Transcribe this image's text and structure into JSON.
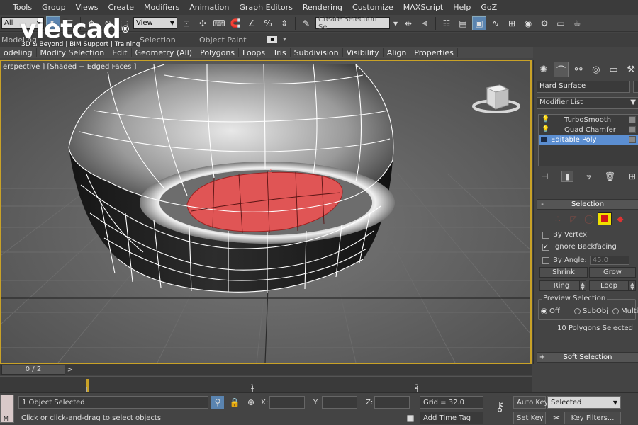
{
  "menu": [
    "Tools",
    "Group",
    "Views",
    "Create",
    "Modifiers",
    "Animation",
    "Graph Editors",
    "Rendering",
    "Customize",
    "MAXScript",
    "Help",
    "GoZ"
  ],
  "toolbar": {
    "filter_value": "All",
    "refcoord_value": "View",
    "named_selection_placeholder": "Create Selection Se"
  },
  "logo": {
    "brand": "vietcad",
    "registered": "®",
    "tagline": "3D & Beyond | BIM Support | Training"
  },
  "ribbon": {
    "row1": [
      "Modeling",
      "Selection",
      "Object Paint"
    ],
    "row2": [
      "odeling",
      "Modify Selection",
      "Edit",
      "Geometry (All)",
      "Polygons",
      "Loops",
      "Tris",
      "Subdivision",
      "Visibility",
      "Align",
      "Properties"
    ]
  },
  "viewport": {
    "label": "erspective ] [Shaded + Edged Faces ]"
  },
  "command_panel": {
    "object_name": "Hard Surface",
    "modifier_list": "Modifier List",
    "stack": [
      {
        "name": "TurboSmooth",
        "selected": false
      },
      {
        "name": "Quad Chamfer",
        "selected": false
      },
      {
        "name": "Editable Poly",
        "selected": true
      }
    ],
    "selection_rollout": {
      "title": "Selection",
      "by_vertex": "By Vertex",
      "ignore_backfacing": "Ignore Backfacing",
      "ignore_backfacing_checked": true,
      "by_angle": "By Angle:",
      "angle_value": "45.0",
      "shrink": "Shrink",
      "grow": "Grow",
      "ring": "Ring",
      "loop": "Loop",
      "preview_selection": "Preview Selection",
      "preview_options": [
        "Off",
        "SubObj",
        "Multi"
      ],
      "preview_selected": "Off",
      "status": "10 Polygons Selected"
    },
    "soft_selection_title": "Soft Selection",
    "minus": "-",
    "plus": "+"
  },
  "timeline": {
    "frame_counter": "0 / 2",
    "next_label": ">",
    "tick_labels": [
      "1",
      "2"
    ]
  },
  "statusbar": {
    "selected_text": "1 Object Selected",
    "prompt": "Click or click-and-drag to select objects",
    "x_label": "X:",
    "y_label": "Y:",
    "z_label": "Z:",
    "grid": "Grid = 32.0",
    "add_time_tag": "Add Time Tag",
    "auto_key": "Auto Key",
    "set_key": "Set Key",
    "key_mode_value": "Selected",
    "key_filters": "Key Filters...",
    "max_label": "M"
  },
  "colors": {
    "viewport_border": "#c9a227",
    "selected_poly": "#e05555",
    "stack_highlight": "#5b8ed1",
    "active_level": "#f0e000"
  }
}
